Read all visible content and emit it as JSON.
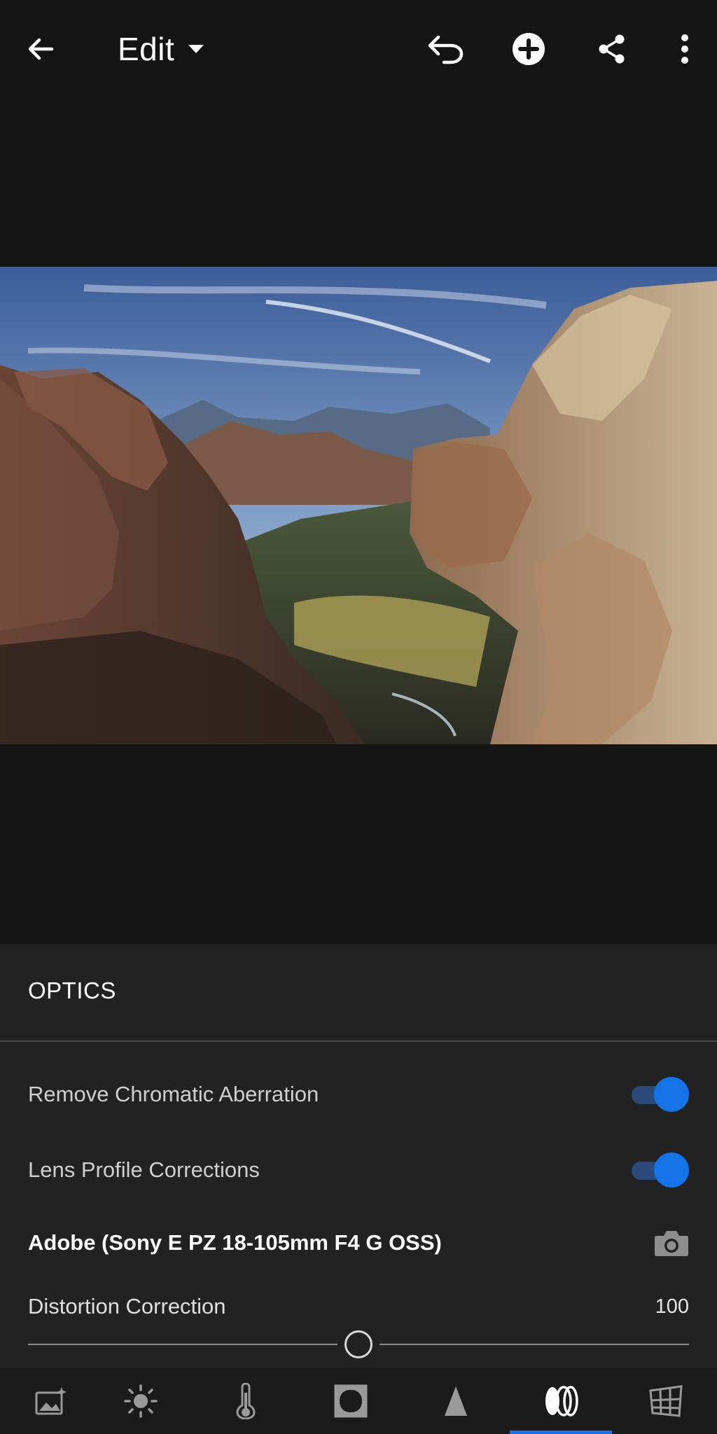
{
  "header": {
    "title": "Edit",
    "icons": [
      "back-arrow-icon",
      "chevron-down-icon",
      "undo-icon",
      "add-circle-icon",
      "share-icon",
      "more-vertical-icon"
    ]
  },
  "photo": {
    "subject": "canyon-landscape"
  },
  "optics": {
    "title": "OPTICS",
    "chromatic": {
      "label": "Remove Chromatic Aberration",
      "enabled": true
    },
    "lens_profile": {
      "label": "Lens Profile Corrections",
      "enabled": true
    },
    "profile": {
      "label": "Adobe (Sony E PZ 18-105mm F4 G OSS)",
      "icon": "camera-icon"
    },
    "distortion": {
      "label": "Distortion Correction",
      "value": "100"
    }
  },
  "toolbar": {
    "tools": [
      "presets-icon",
      "light-icon",
      "color-temperature-icon",
      "effects-vignette-icon",
      "detail-icon",
      "optics-icon",
      "geometry-icon"
    ],
    "active": "optics-icon"
  },
  "colors": {
    "accent": "#1473e6",
    "panel": "#222222",
    "background": "#141414"
  }
}
